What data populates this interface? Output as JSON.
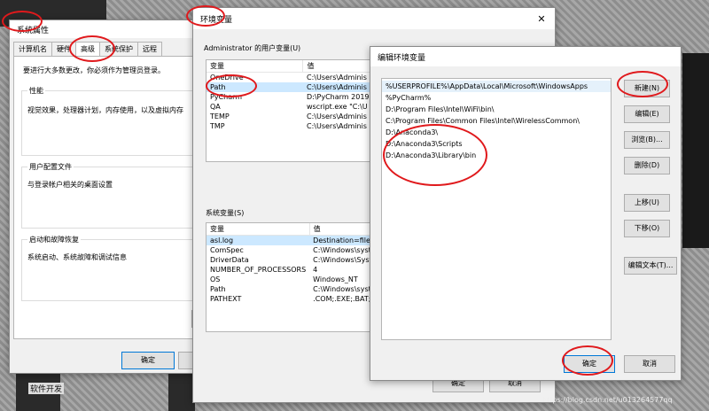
{
  "background": {
    "caption": "软件开发"
  },
  "system_props": {
    "title": "系统属性",
    "tabs": [
      "计算机名",
      "硬件",
      "高级",
      "系统保护",
      "远程"
    ],
    "admin_note": "要进行大多数更改，你必须作为管理员登录。",
    "performance": {
      "title": "性能",
      "desc": "视觉效果，处理器计划，内存使用，以及虚拟内存"
    },
    "profile": {
      "title": "用户配置文件",
      "desc": "与登录帐户相关的桌面设置"
    },
    "startup": {
      "title": "启动和故障恢复",
      "desc": "系统启动、系统故障和调试信息"
    },
    "ok": "确定"
  },
  "env_vars": {
    "title": "环境变量",
    "user_section": "Administrator 的用户变量(U)",
    "col_var": "变量",
    "col_val": "值",
    "user_rows": [
      {
        "name": "OneDrive",
        "value": "C:\\Users\\Adminis"
      },
      {
        "name": "Path",
        "value": "C:\\Users\\Adminis"
      },
      {
        "name": "PyCharm",
        "value": "D:\\PyCharm 2019"
      },
      {
        "name": "QA",
        "value": "wscript.exe \"C:\\U"
      },
      {
        "name": "TEMP",
        "value": "C:\\Users\\Adminis"
      },
      {
        "name": "TMP",
        "value": "C:\\Users\\Adminis"
      }
    ],
    "sys_section": "系统变量(S)",
    "sys_rows": [
      {
        "name": "asl.log",
        "value": "Destination=file"
      },
      {
        "name": "ComSpec",
        "value": "C:\\Windows\\syst"
      },
      {
        "name": "DriverData",
        "value": "C:\\Windows\\Syst"
      },
      {
        "name": "NUMBER_OF_PROCESSORS",
        "value": "4"
      },
      {
        "name": "OS",
        "value": "Windows_NT"
      },
      {
        "name": "Path",
        "value": "C:\\Windows\\syst"
      },
      {
        "name": "PATHEXT",
        "value": ".COM;.EXE;.BAT;."
      }
    ],
    "ok": "确定",
    "cancel": "取消"
  },
  "edit_env": {
    "title": "编辑环境变量",
    "paths": [
      "%USERPROFILE%\\AppData\\Local\\Microsoft\\WindowsApps",
      "%PyCharm%",
      "D:\\Program Files\\Intel\\WiFi\\bin\\",
      "C:\\Program Files\\Common Files\\Intel\\WirelessCommon\\",
      "D:\\Anaconda3\\",
      "D:\\Anaconda3\\Scripts",
      "D:\\Anaconda3\\Library\\bin"
    ],
    "buttons": {
      "new": "新建(N)",
      "edit": "编辑(E)",
      "browse": "浏览(B)...",
      "delete": "删除(D)",
      "up": "上移(U)",
      "down": "下移(O)",
      "edit_text": "编辑文本(T)..."
    },
    "ok": "确定",
    "cancel": "取消"
  },
  "watermark": "https://blog.csdn.net/u013264577qq"
}
